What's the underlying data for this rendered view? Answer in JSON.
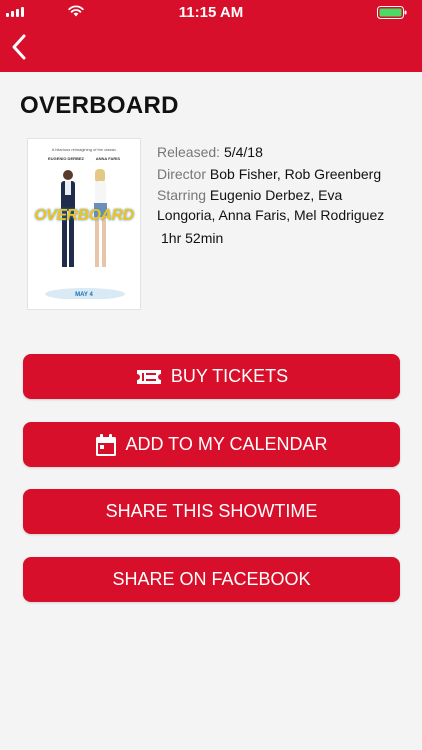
{
  "status_bar": {
    "time": "11:15 AM",
    "icons": [
      "signal-icon",
      "wifi-icon",
      "battery-icon"
    ]
  },
  "nav": {
    "back_icon": "chevron-left-icon"
  },
  "colors": {
    "brand_red": "#d80f2a",
    "background": "#f4f4f4"
  },
  "movie": {
    "title": "OVERBOARD",
    "released_label": "Released:",
    "released_value": "5/4/18",
    "director_label": "Director",
    "director_value": "Bob Fisher, Rob Greenberg",
    "starring_label": "Starring",
    "starring_value": "Eugenio Derbez, Eva Longoria, Anna Faris, Mel Rodriguez",
    "runtime": "1hr 52min"
  },
  "poster": {
    "tagline": "A hilarious reimagining of the classic",
    "actor_left": "EUGENIO DERBEZ",
    "actor_right": "ANNA FARIS",
    "title": "OVERBOARD",
    "date": "MAY 4"
  },
  "actions": {
    "buy_tickets": "BUY TICKETS",
    "add_calendar": "ADD TO MY CALENDAR",
    "share_showtime": "SHARE THIS SHOWTIME",
    "share_facebook": "SHARE ON FACEBOOK"
  }
}
